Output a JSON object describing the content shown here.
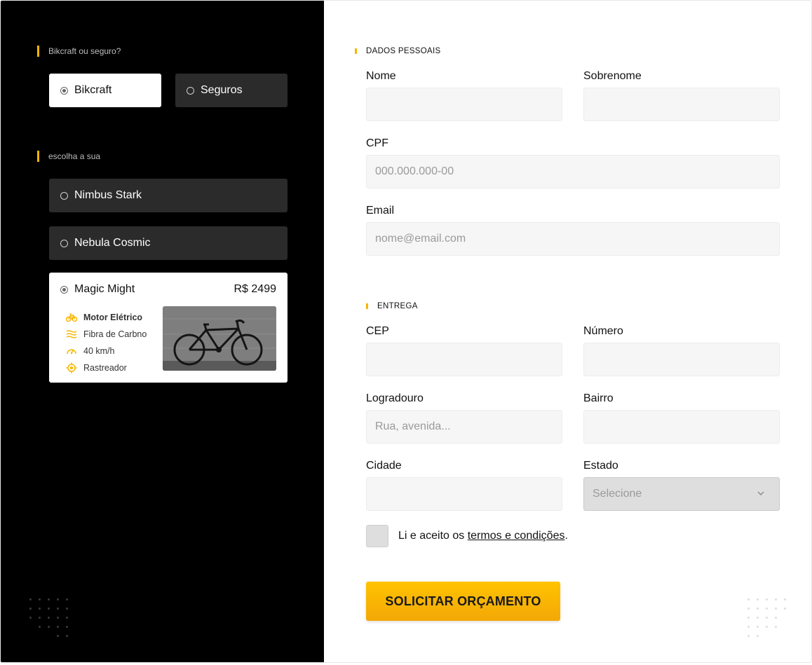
{
  "left": {
    "brand_question": "Bikcraft ou seguro?",
    "type_options": [
      {
        "label": "Bikcraft",
        "selected": true
      },
      {
        "label": "Seguros",
        "selected": false
      }
    ],
    "choose_label": "escolha a sua",
    "bikes": [
      {
        "label": "Nimbus Stark",
        "selected": false
      },
      {
        "label": "Nebula Cosmic",
        "selected": false
      },
      {
        "label": "Magic Might",
        "selected": true,
        "price": "R$ 2499"
      }
    ],
    "features": [
      {
        "label": "Motor Elétrico",
        "icon": "electric-bike-icon"
      },
      {
        "label": "Fibra de Carbno",
        "icon": "carbon-fiber-icon"
      },
      {
        "label": "40 km/h",
        "icon": "speedometer-icon"
      },
      {
        "label": "Rastreador",
        "icon": "tracker-icon"
      }
    ]
  },
  "form": {
    "personal_section": "DADOS PESSOAIS",
    "delivery_section": "ENTREGA",
    "fields": {
      "nome": {
        "label": "Nome",
        "value": "",
        "placeholder": ""
      },
      "sobrenome": {
        "label": "Sobrenome",
        "value": "",
        "placeholder": ""
      },
      "cpf": {
        "label": "CPF",
        "value": "",
        "placeholder": "000.000.000-00"
      },
      "email": {
        "label": "Email",
        "value": "",
        "placeholder": "nome@email.com"
      },
      "cep": {
        "label": "CEP",
        "value": "",
        "placeholder": ""
      },
      "numero": {
        "label": "Número",
        "value": "",
        "placeholder": ""
      },
      "logradouro": {
        "label": "Logradouro",
        "value": "",
        "placeholder": "Rua, avenida..."
      },
      "bairro": {
        "label": "Bairro",
        "value": "",
        "placeholder": ""
      },
      "cidade": {
        "label": "Cidade",
        "value": "",
        "placeholder": ""
      },
      "estado": {
        "label": "Estado",
        "selected": "Selecione"
      }
    },
    "terms": {
      "prefix": "Li e aceito os ",
      "link": "termos e condições",
      "suffix": "."
    },
    "submit_label": "SOLICITAR ORÇAMENTO"
  },
  "colors": {
    "accent": "#F7B500",
    "dark_panel": "#000000",
    "option_dark": "#2b2b2b",
    "input_bg": "#f6f6f6"
  }
}
